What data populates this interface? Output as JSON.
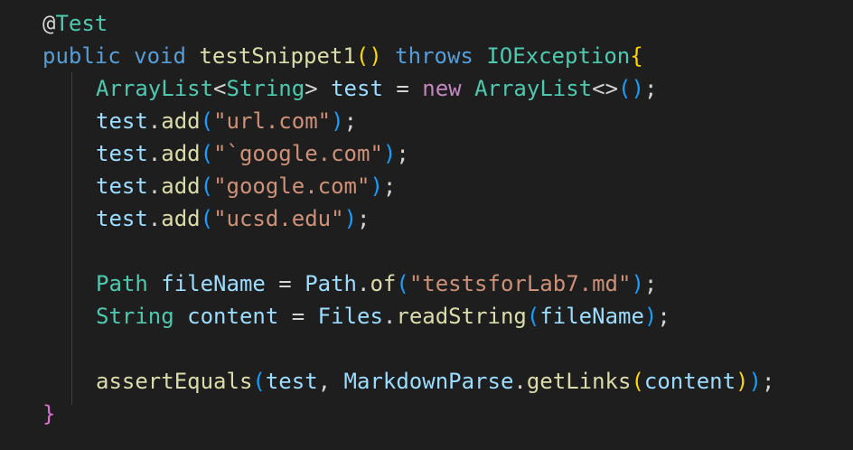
{
  "editor": {
    "annotation": {
      "at": "@",
      "name": "Test"
    },
    "signature": {
      "modifier": "public",
      "return_type": "void",
      "method_name": "testSnippet1",
      "throws_kw": "throws",
      "exception": "IOException"
    },
    "line_list_decl": {
      "type": "ArrayList",
      "generic": "String",
      "var": "test",
      "new_kw": "new",
      "ctor": "ArrayList"
    },
    "add_calls": [
      {
        "obj": "test",
        "method": "add",
        "arg": "\"url.com\""
      },
      {
        "obj": "test",
        "method": "add",
        "arg": "\"`google.com\""
      },
      {
        "obj": "test",
        "method": "add",
        "arg": "\"google.com\""
      },
      {
        "obj": "test",
        "method": "add",
        "arg": "\"ucsd.edu\""
      }
    ],
    "path_decl": {
      "type": "Path",
      "var": "fileName",
      "cls": "Path",
      "method": "of",
      "arg": "\"testsforLab7.md\""
    },
    "content_decl": {
      "type": "String",
      "var": "content",
      "cls": "Files",
      "method": "readString",
      "arg": "fileName"
    },
    "assert_line": {
      "fn": "assertEquals",
      "arg1": "test",
      "cls": "MarkdownParse",
      "method": "getLinks",
      "arg": "content"
    },
    "closing_brace": "}"
  }
}
